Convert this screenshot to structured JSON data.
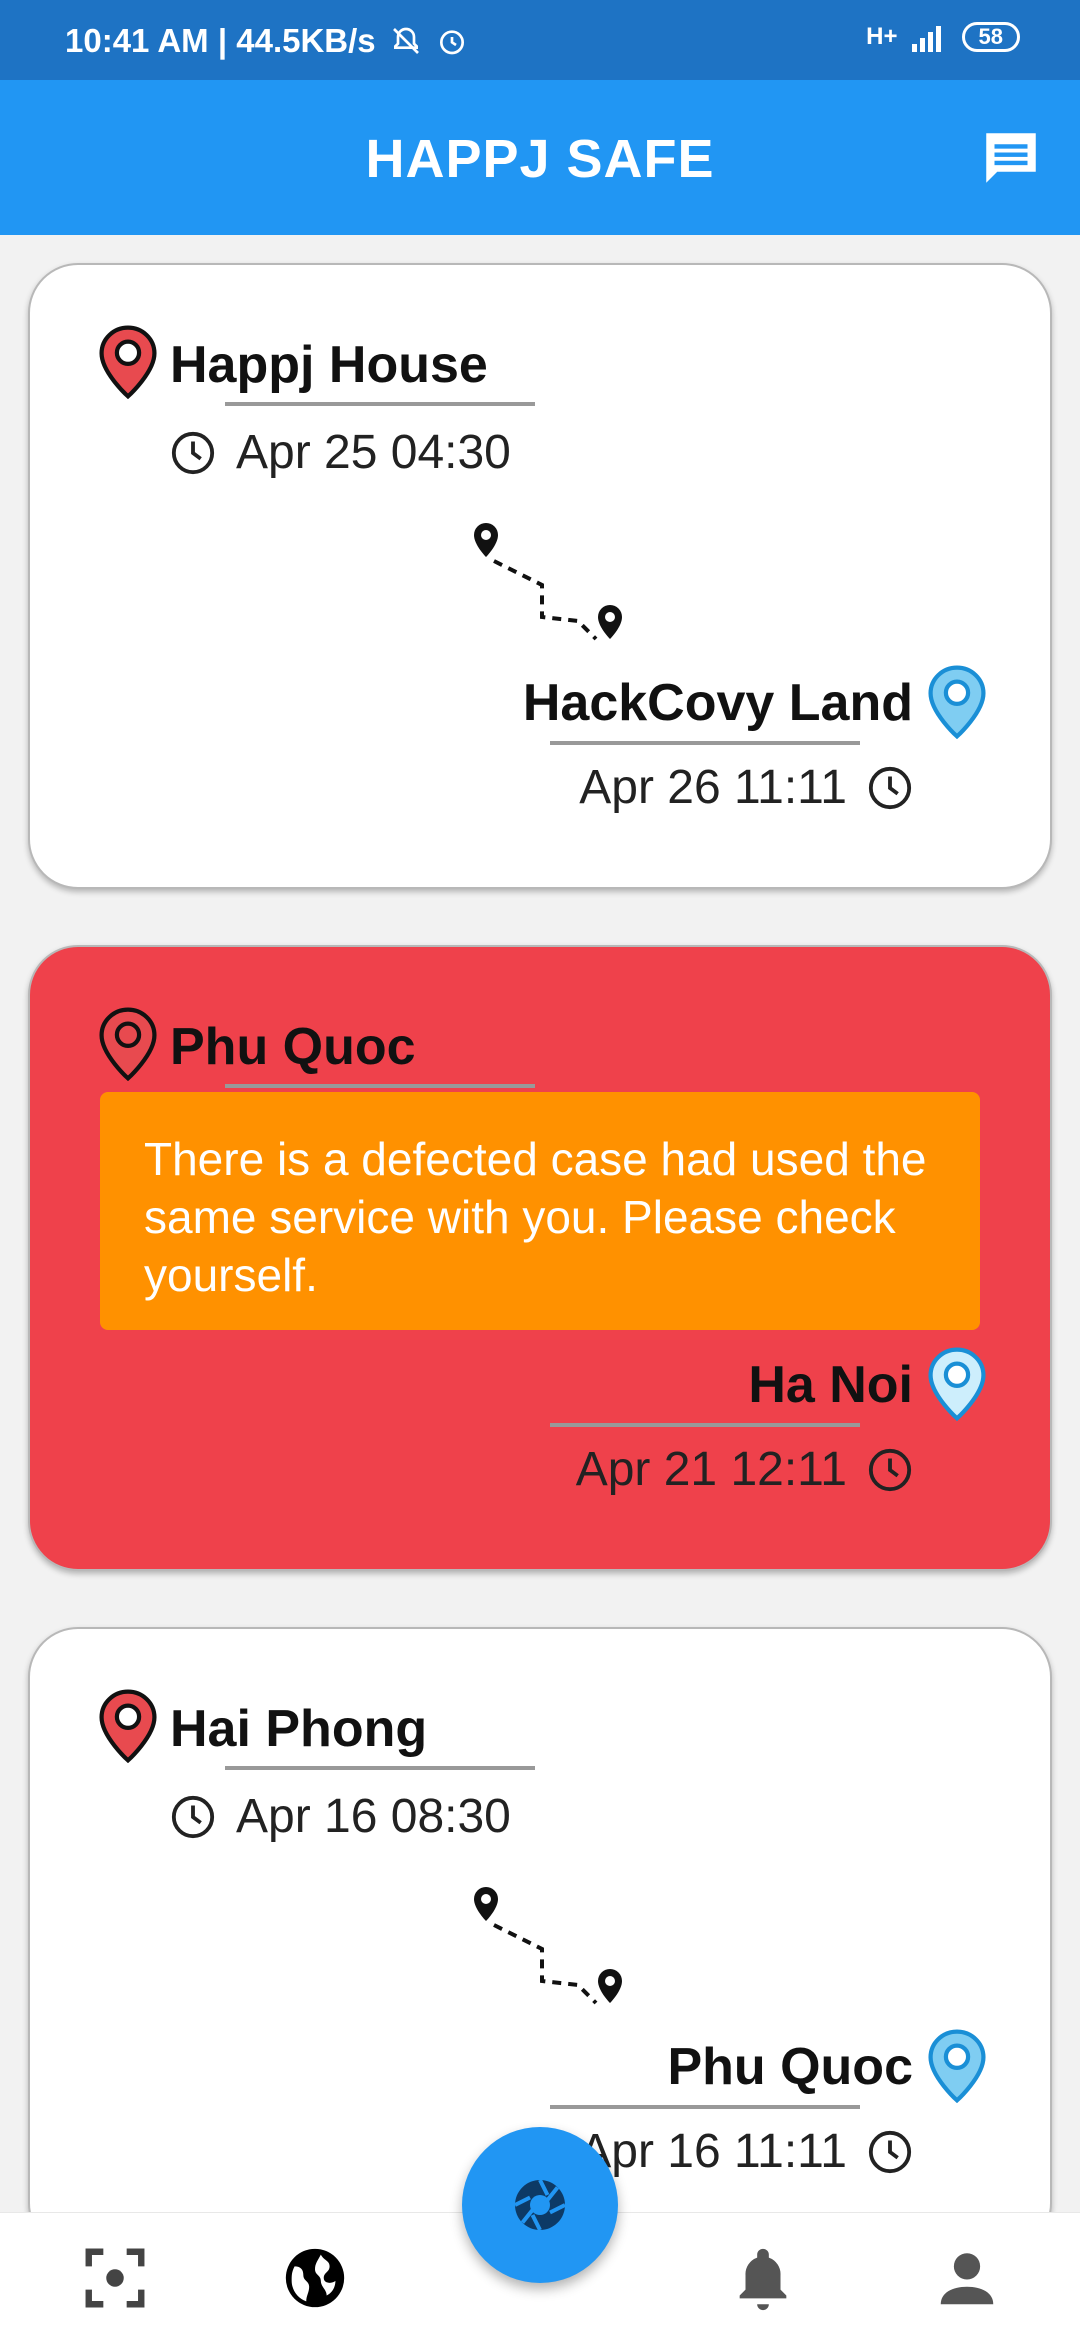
{
  "status_bar": {
    "time": "10:41 AM | 44.5KB/s",
    "network": "H+",
    "battery": "58"
  },
  "app_bar": {
    "title": "HAPPJ SAFE",
    "chat_icon": "chat-icon"
  },
  "colors": {
    "primary": "#2196f3",
    "status_bar": "#1e73c4",
    "alert_card": "#ef414b",
    "warning_box": "#ff9100",
    "origin_pin": "#e84a4f",
    "dest_pin": "#7fcdf2"
  },
  "trips": [
    {
      "origin": "Happj House",
      "origin_time": "Apr 25 04:30",
      "destination": "HackCovy Land",
      "destination_time": "Apr 26 11:11",
      "alert": false
    },
    {
      "origin": "Phu Quoc",
      "warning": "There is a defected case had used the same service with you. Please check yourself.",
      "destination": "Ha Noi",
      "destination_time": "Apr 21 12:11",
      "alert": true
    },
    {
      "origin": "Hai Phong",
      "origin_time": "Apr 16 08:30",
      "destination": "Phu Quoc",
      "destination_time": "Apr 16 11:11",
      "alert": false
    }
  ],
  "bottom_nav": {
    "items": [
      "scan-icon",
      "globe-icon",
      "camera-icon",
      "bell-icon",
      "person-icon"
    ],
    "active": "globe-icon"
  }
}
